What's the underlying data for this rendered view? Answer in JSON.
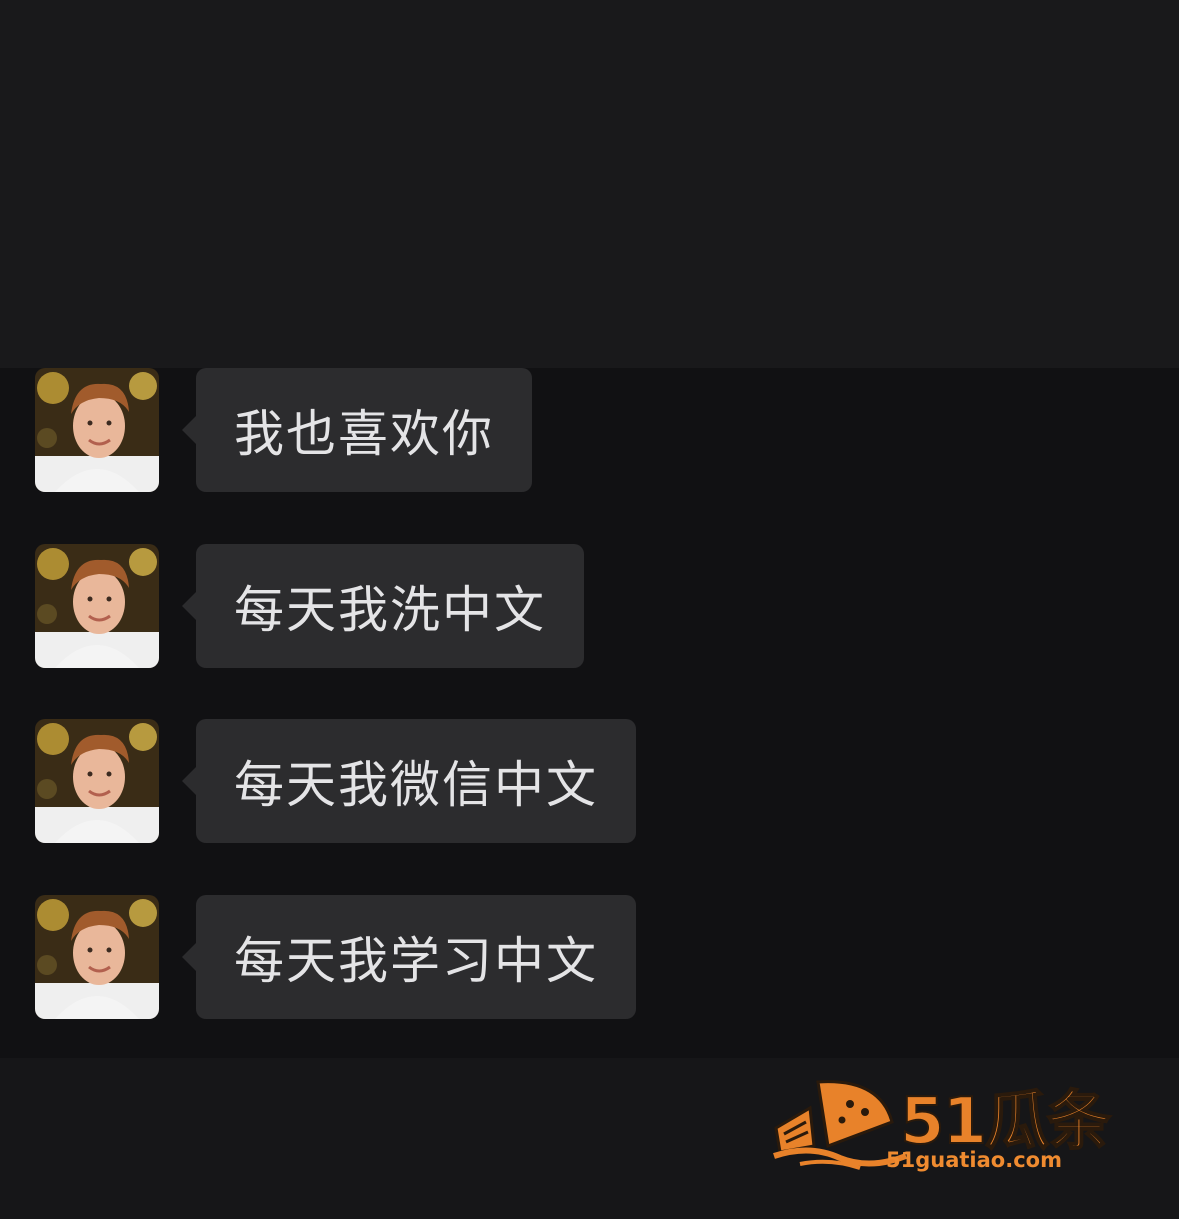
{
  "messages": [
    {
      "text": "我也喜欢你"
    },
    {
      "text": "每天我洗中文"
    },
    {
      "text": "每天我微信中文"
    },
    {
      "text": "每天我学习中文"
    }
  ],
  "watermark": {
    "brand": "51瓜条",
    "url": "51guatiao.com",
    "color": "#e8822a"
  },
  "colors": {
    "background": "#111113",
    "bubble": "#2c2c2e",
    "text": "#e4e4e6"
  }
}
